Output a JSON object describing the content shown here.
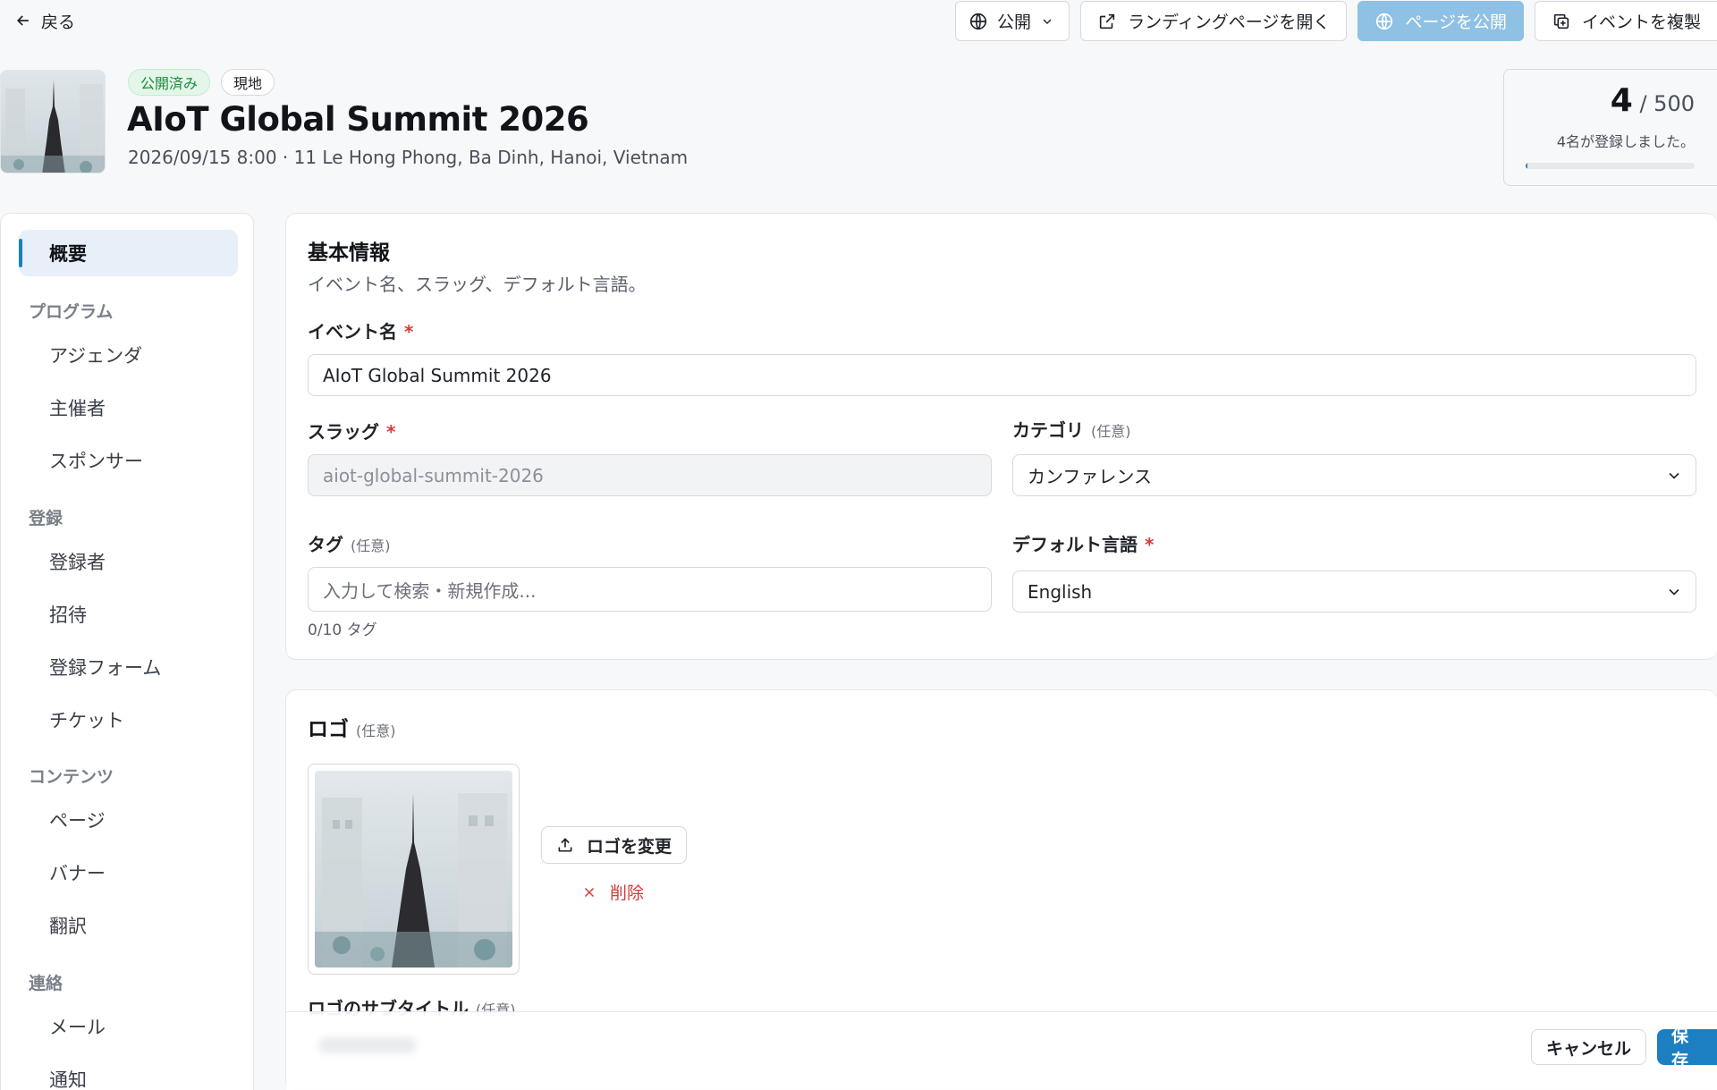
{
  "topbar": {
    "back_label": "戻る",
    "visibility_label": "公開",
    "open_landing_label": "ランディングページを開く",
    "publish_label": "ページを公開",
    "duplicate_label": "イベントを複製"
  },
  "event": {
    "status_badge": "公開済み",
    "type_badge": "現地",
    "title": "AIoT Global Summit 2026",
    "subtitle": "2026/09/15 8:00 · 11 Le Hong Phong, Ba Dinh, Hanoi, Vietnam"
  },
  "capacity": {
    "registered": "4",
    "limit": "/ 500",
    "text": "4名が登録しました。",
    "progress_fraction": 0.008
  },
  "sidebar": {
    "overview": "概要",
    "groups": [
      {
        "label": "プログラム",
        "items": [
          "アジェンダ",
          "主催者",
          "スポンサー"
        ]
      },
      {
        "label": "登録",
        "items": [
          "登録者",
          "招待",
          "登録フォーム",
          "チケット"
        ]
      },
      {
        "label": "コンテンツ",
        "items": [
          "ページ",
          "バナー",
          "翻訳"
        ]
      },
      {
        "label": "連絡",
        "items": [
          "メール",
          "通知"
        ]
      }
    ]
  },
  "basic": {
    "title": "基本情報",
    "desc": "イベント名、スラッグ、デフォルト言語。",
    "name_label": "イベント名",
    "name_value": "AIoT Global Summit 2026",
    "slug_label": "スラッグ",
    "slug_value": "aiot-global-summit-2026",
    "category_label": "カテゴリ",
    "category_value": "カンファレンス",
    "tag_label": "タグ",
    "tag_placeholder": "入力して検索・新規作成...",
    "tag_hint": "0/10 タグ",
    "lang_label": "デフォルト言語",
    "lang_value": "English",
    "required_mark": "*",
    "optional_mark": "(任意)"
  },
  "logo": {
    "title": "ロゴ",
    "optional_mark": "(任意)",
    "change_label": "ロゴを変更",
    "delete_label": "削除",
    "subtitle_label": "ロゴのサブタイトル"
  },
  "footer": {
    "cancel_label": "キャンセル",
    "save_label": "保存"
  },
  "colors": {
    "accent": "#1b7fc1",
    "published_green": "#1c8a3c",
    "danger": "#d63a3a"
  }
}
